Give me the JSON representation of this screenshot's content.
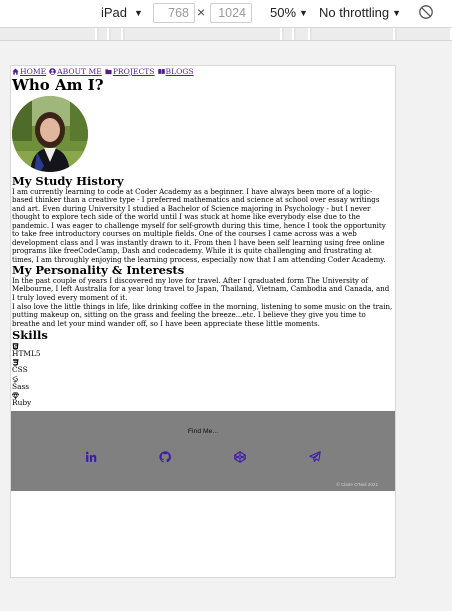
{
  "devtools": {
    "device": "iPad",
    "width": "768",
    "height": "1024",
    "dimension_separator": "×",
    "zoom": "50%",
    "throttle": "No throttling",
    "caret": "▼"
  },
  "nav": {
    "items": [
      {
        "icon": "home-icon",
        "label": "HOME"
      },
      {
        "icon": "user-circle-icon",
        "label": "ABOUT ME"
      },
      {
        "icon": "folder-icon",
        "label": "PROJECTS"
      },
      {
        "icon": "book-icon",
        "label": "BLOGS"
      }
    ]
  },
  "page": {
    "title": "Who Am I?",
    "study_heading": "My Study History",
    "study_text": "I am currently learning to code at Coder Academy as a beginner. I have always been more of a logic-based thinker than a creative type - I preferred mathematics and science at school over essay writings and art. Even during University I studied a Bachelor of Science majoring in Psychology - but I never thought to explore tech side of the world until I was stuck at home like everybody else due to the pandemic. I was eager to challenge myself for self-growth during this time, hence I took the opportunity to take free introductory courses on multiple fields. One of the courses I came across was a web development class and I was instantly drawn to it. From then I have been self learning using free online programs like freeCodeCamp, Dash and codecademy. While it is quite challenging and frustrating at times, I am throughly enjoying the learning process, especially now that I am attending Coder Academy.",
    "personality_heading": "My Personality & Interests",
    "personality_text_1": "In the past couple of years I discovered my love for travel. After I graduated form The University of Melbourne, I left Australia for a year long travel to Japan, Thailand, Vietnam, Cambodia and Canada, and I truly loved every moment of it.",
    "personality_text_2": "I also love the little things in life, like drinking coffee in the morning, listening to some music on the train, putting makeup on, sitting on the grass and feeling the breeze...etc. I believe they give you time to breathe and let your mind wander off, so I have been appreciate these little moments.",
    "skills_heading": "Skills",
    "skills": [
      {
        "icon": "html5-icon",
        "label": "HTML5"
      },
      {
        "icon": "css3-icon",
        "label": "CSS"
      },
      {
        "icon": "sass-icon",
        "label": "Sass"
      },
      {
        "icon": "ruby-icon",
        "label": "Ruby"
      }
    ]
  },
  "footer": {
    "find_label": "Find Me...",
    "socials": [
      {
        "icon": "linkedin-icon"
      },
      {
        "icon": "github-icon"
      },
      {
        "icon": "codepen-icon"
      },
      {
        "icon": "telegram-icon"
      }
    ],
    "copyright": "© Claire O'Neil 2021",
    "icon_color": "#3f1ca8",
    "background": "#808080"
  }
}
